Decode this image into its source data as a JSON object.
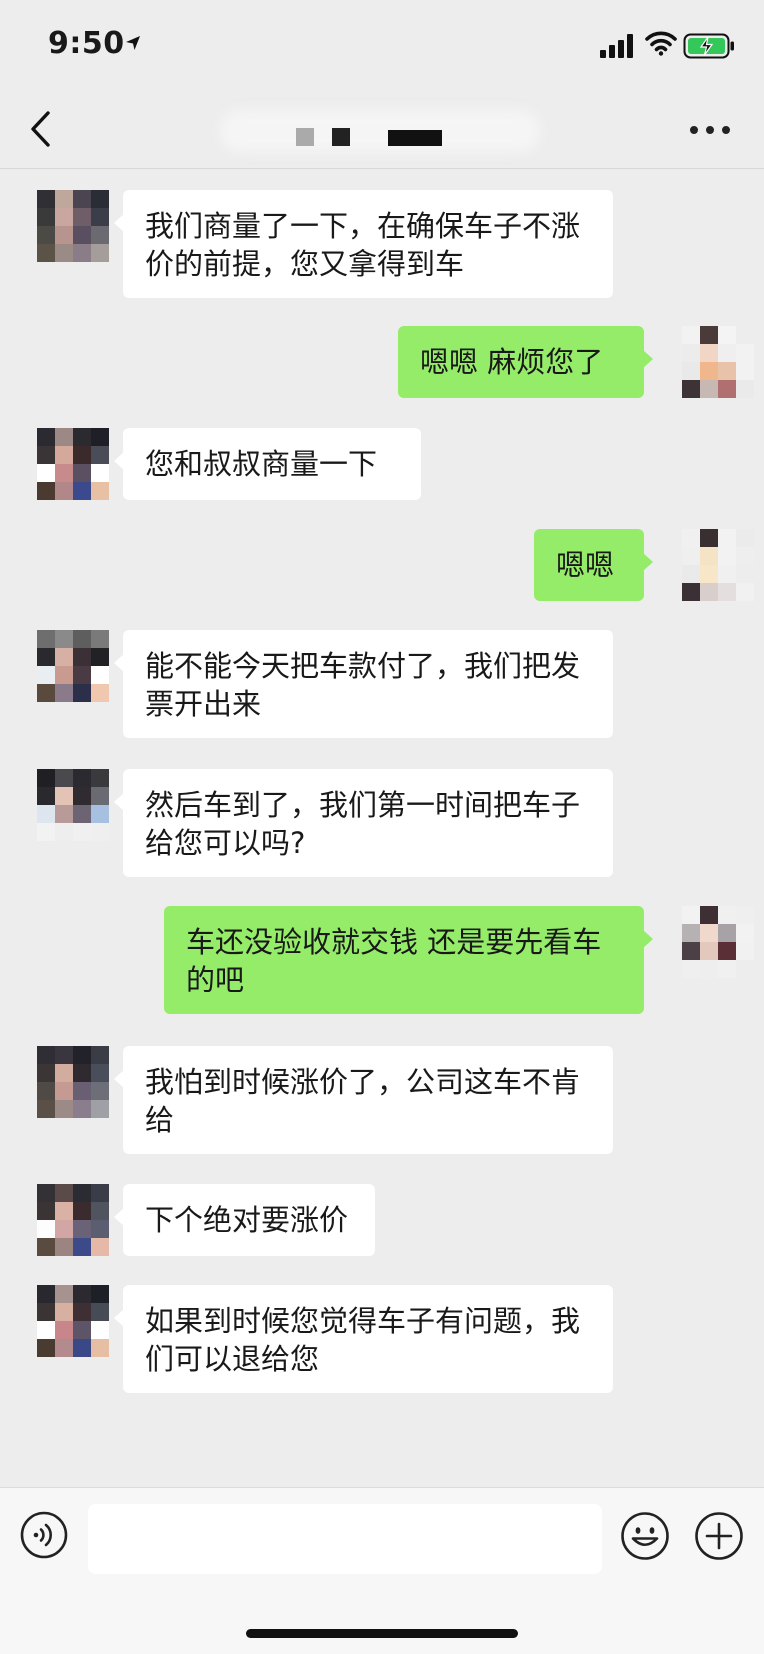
{
  "status": {
    "time": "9:50"
  },
  "composer": {
    "placeholder": ""
  },
  "messages": [
    {
      "side": "in",
      "lines": [
        "我们商量了一下，在确保车子不涨",
        "价的前提，您又拿得到车"
      ],
      "avatar": [
        "#2f2f35",
        "#bfa79c",
        "#4a4550",
        "#2a2d36",
        "#3a3a3a",
        "#c9a7a0",
        "#6f5e68",
        "#3b3e48",
        "#4b4a44",
        "#b8948f",
        "#5a4f60",
        "#6a6a70",
        "#5b5248",
        "#9a8b86",
        "#8a7d88",
        "#a49d9a"
      ]
    },
    {
      "side": "out",
      "lines": [
        "嗯嗯 麻烦您了"
      ],
      "avatar": [
        "#f2f2f2",
        "#4a3a3a",
        "#f4f4f4",
        "#ededed",
        "#ececec",
        "#f1d6c6",
        "#efefef",
        "#f2f2f2",
        "#e9e9e9",
        "#f0b68c",
        "#e8c2a9",
        "#f2f2f2",
        "#3d3236",
        "#c7b8b4",
        "#b07070",
        "#eaeaea"
      ]
    },
    {
      "side": "in",
      "lines": [
        "您和叔叔商量一下"
      ],
      "avatar": [
        "#2a2a30",
        "#9c8884",
        "#2b2a2e",
        "#1f2027",
        "#3a3436",
        "#d4a89b",
        "#3b2a2c",
        "#4a4c58",
        "#ffffff",
        "#c98a8c",
        "#5a5062",
        "#ffffff",
        "#4a3a30",
        "#b1878a",
        "#3b4a8c",
        "#e8c0a4"
      ]
    },
    {
      "side": "out",
      "lines": [
        "嗯嗯"
      ],
      "avatar": [
        "#f0f0f0",
        "#3a2f30",
        "#f2f2f2",
        "#ebebeb",
        "#efefef",
        "#f5e3c6",
        "#f2f2f2",
        "#eeeeee",
        "#eaeaea",
        "#f7e6c8",
        "#f0f0f0",
        "#ededed",
        "#3a3035",
        "#d8cfcd",
        "#e5dede",
        "#f1f1f1"
      ]
    },
    {
      "side": "in",
      "lines": [
        "能不能今天把车款付了，我们把发",
        "票开出来"
      ],
      "avatar": [
        "#6e6e6e",
        "#8a8a8a",
        "#5e5e5e",
        "#7a7a7a",
        "#2a2a2e",
        "#d6b0a4",
        "#3b3035",
        "#222226",
        "#e8eef2",
        "#c99a90",
        "#4a3a44",
        "#ffffff",
        "#5a4a3e",
        "#8a7a8a",
        "#2c2f4a",
        "#f0c8b0"
      ]
    },
    {
      "side": "in",
      "lines": [
        "然后车到了，我们第一时间把车子",
        "给您可以吗?"
      ],
      "avatar": [
        "#1f1f24",
        "#4a4a4e",
        "#2a2a30",
        "#3a3a3e",
        "#2a2a2e",
        "#e2c3b6",
        "#2f2b30",
        "#6a6a72",
        "#dde6ee",
        "#b89a98",
        "#6c6472",
        "#a8c0e0",
        "#f2f2f2",
        "#eeeeee",
        "#f0f0f0",
        "#efefef"
      ]
    },
    {
      "side": "out",
      "lines": [
        "车还没验收就交钱 还是要先看车",
        "的吧"
      ],
      "avatar": [
        "#f2f2f2",
        "#3e2f35",
        "#f0f0f0",
        "#efefef",
        "#b6b2b4",
        "#f0d8cc",
        "#a7a2a5",
        "#f2f2f2",
        "#4a4046",
        "#e2c8bd",
        "#5a2f35",
        "#f1f1f1",
        "#efefef",
        "#eeeeee",
        "#f0f0f0",
        "#ededed"
      ]
    },
    {
      "side": "in",
      "lines": [
        "我怕到时候涨价了，公司这车不肯",
        "给"
      ],
      "avatar": [
        "#2e2e34",
        "#3a3640",
        "#22232a",
        "#3a3c46",
        "#3b3535",
        "#d2ad9f",
        "#2e2a30",
        "#4a4e5a",
        "#4f4a46",
        "#c49a92",
        "#6a5e72",
        "#6c6e78",
        "#5a5048",
        "#9c8a86",
        "#8a7e8e",
        "#9fa0a6"
      ]
    },
    {
      "side": "in",
      "lines": [
        "下个绝对要涨价"
      ],
      "avatar": [
        "#333036",
        "#5a4a4a",
        "#2a2b33",
        "#3a3d48",
        "#3a3434",
        "#d9b2a5",
        "#3a2c2e",
        "#50545f",
        "#fdfdfd",
        "#d2a6a5",
        "#6a6276",
        "#5a5e70",
        "#5a4b40",
        "#9c8580",
        "#3c4a8a",
        "#e6b8a8"
      ]
    },
    {
      "side": "in",
      "lines": [
        "如果到时候您觉得车子有问题，我",
        "们可以退给您"
      ],
      "avatar": [
        "#28282e",
        "#a6928e",
        "#2c2a30",
        "#1e2028",
        "#3a3434",
        "#d8b0a2",
        "#3d2f33",
        "#474b56",
        "#ffffff",
        "#c8868a",
        "#5e5468",
        "#ffffff",
        "#4a3b31",
        "#b38b8e",
        "#3a4888",
        "#e6bea4"
      ]
    }
  ]
}
